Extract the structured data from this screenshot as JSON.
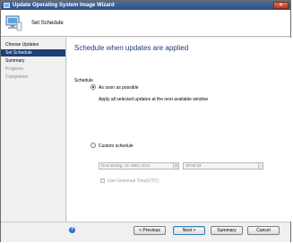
{
  "window": {
    "title": "Update Operating System Image Wizard"
  },
  "header": {
    "title": "Set Schedule"
  },
  "sidebar": {
    "items": [
      {
        "label": "Choose Updates",
        "state": "done"
      },
      {
        "label": "Set Schedule",
        "state": "active"
      },
      {
        "label": "Summary",
        "state": "normal"
      },
      {
        "label": "Progress",
        "state": "disabled"
      },
      {
        "label": "Completion",
        "state": "disabled"
      }
    ]
  },
  "main": {
    "heading": "Schedule when updates are applied",
    "schedule_label": "Schedule",
    "asap": {
      "label": "As soon as possible",
      "description": "Apply all selected updates at the next available window",
      "checked": true
    },
    "custom": {
      "label": "Custom schedule",
      "checked": false,
      "date_value": "Donnerstag, 15.    März    2012",
      "time_value": "09:56:33",
      "utc_label": "Use Universal Time(UTC)",
      "utc_checked": false
    }
  },
  "footer": {
    "help_glyph": "?",
    "previous_label": "< Previous",
    "next_label": "Next >",
    "summary_label": "Summary",
    "cancel_label": "Cancel"
  },
  "colors": {
    "accent": "#1f3f77",
    "heading": "#1e3a7a",
    "titlebar": "#2c4f83"
  }
}
